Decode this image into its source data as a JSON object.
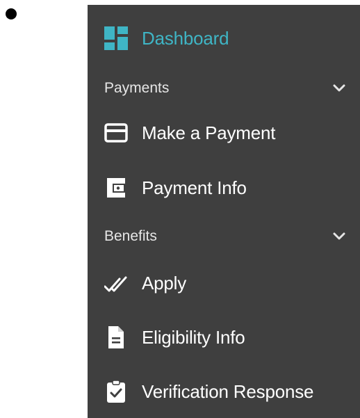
{
  "colors": {
    "sidebar_bg": "#3f3f3f",
    "accent": "#3fb5c5",
    "text": "#ffffff"
  },
  "nav": {
    "dashboard": {
      "label": "Dashboard",
      "icon": "dashboard-grid-icon",
      "active": true
    },
    "payments": {
      "label": "Payments",
      "icon": "chevron-down-icon",
      "items": [
        {
          "label": "Make a Payment",
          "icon": "credit-card-icon"
        },
        {
          "label": "Payment Info",
          "icon": "wallet-icon"
        }
      ]
    },
    "benefits": {
      "label": "Benefits",
      "icon": "chevron-down-icon",
      "items": [
        {
          "label": "Apply",
          "icon": "double-check-icon"
        },
        {
          "label": "Eligibility Info",
          "icon": "document-icon"
        },
        {
          "label": "Verification Response",
          "icon": "clipboard-check-icon"
        }
      ]
    }
  }
}
